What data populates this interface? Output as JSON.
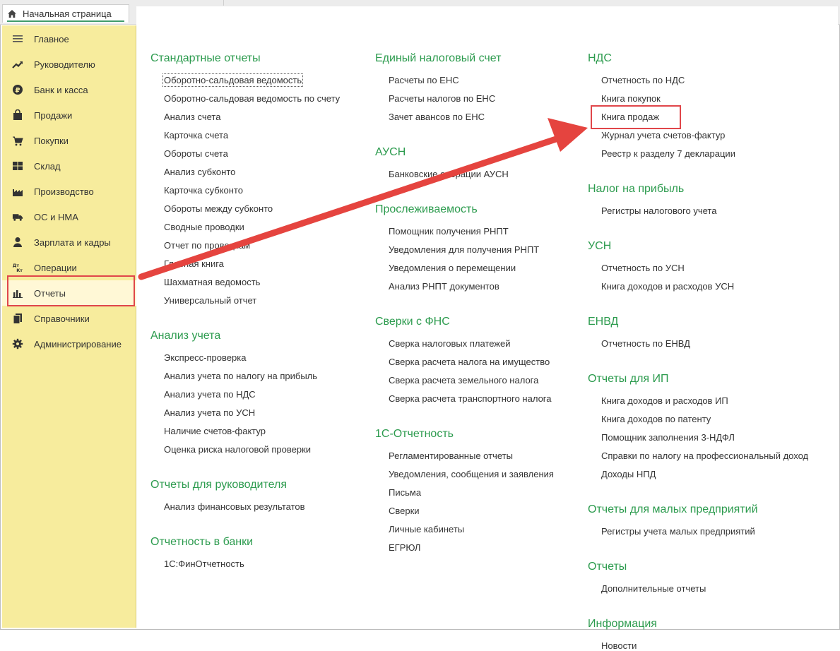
{
  "window": {
    "home_tab": "Начальная страница"
  },
  "sidebar": {
    "items": [
      {
        "label": "Главное",
        "icon": "menu-lines-icon"
      },
      {
        "label": "Руководителю",
        "icon": "trend-up-icon"
      },
      {
        "label": "Банк и касса",
        "icon": "ruble-coin-icon"
      },
      {
        "label": "Продажи",
        "icon": "shopping-bag-icon"
      },
      {
        "label": "Покупки",
        "icon": "cart-icon"
      },
      {
        "label": "Склад",
        "icon": "warehouse-grid-icon"
      },
      {
        "label": "Производство",
        "icon": "factory-icon"
      },
      {
        "label": "ОС и НМА",
        "icon": "truck-icon"
      },
      {
        "label": "Зарплата и кадры",
        "icon": "person-icon"
      },
      {
        "label": "Операции",
        "icon": "debit-credit-icon"
      },
      {
        "label": "Отчеты",
        "icon": "bar-chart-icon",
        "active": true
      },
      {
        "label": "Справочники",
        "icon": "books-icon"
      },
      {
        "label": "Администрирование",
        "icon": "gear-icon"
      }
    ]
  },
  "columns": [
    {
      "sections": [
        {
          "title": "Стандартные отчеты",
          "links": [
            "Оборотно-сальдовая ведомость",
            "Оборотно-сальдовая ведомость по счету",
            "Анализ счета",
            "Карточка счета",
            "Обороты счета",
            "Анализ субконто",
            "Карточка субконто",
            "Обороты между субконто",
            "Сводные проводки",
            "Отчет по проводкам",
            "Главная книга",
            "Шахматная ведомость",
            "Универсальный отчет"
          ]
        },
        {
          "title": "Анализ учета",
          "links": [
            "Экспресс-проверка",
            "Анализ учета по налогу на прибыль",
            "Анализ учета по НДС",
            "Анализ учета по УСН",
            "Наличие счетов-фактур",
            "Оценка риска налоговой проверки"
          ]
        },
        {
          "title": "Отчеты для руководителя",
          "links": [
            "Анализ финансовых результатов"
          ]
        },
        {
          "title": "Отчетность в банки",
          "links": [
            "1С:ФинОтчетность"
          ]
        }
      ]
    },
    {
      "sections": [
        {
          "title": "Единый налоговый счет",
          "links": [
            "Расчеты по ЕНС",
            "Расчеты налогов по ЕНС",
            "Зачет авансов по ЕНС"
          ]
        },
        {
          "title": "АУСН",
          "links": [
            "Банковские операции АУСН"
          ]
        },
        {
          "title": "Прослеживаемость",
          "links": [
            "Помощник получения РНПТ",
            "Уведомления для получения РНПТ",
            "Уведомления о перемещении",
            "Анализ РНПТ документов"
          ]
        },
        {
          "title": "Сверки с ФНС",
          "links": [
            "Сверка налоговых платежей",
            "Сверка расчета налога на имущество",
            "Сверка расчета земельного налога",
            "Сверка расчета транспортного налога"
          ]
        },
        {
          "title": "1С-Отчетность",
          "links": [
            "Регламентированные отчеты",
            "Уведомления, сообщения и заявления",
            "Письма",
            "Сверки",
            "Личные кабинеты",
            "ЕГРЮЛ"
          ]
        }
      ]
    },
    {
      "sections": [
        {
          "title": "НДС",
          "links": [
            "Отчетность по НДС",
            "Книга покупок",
            "Книга продаж",
            "Журнал учета счетов-фактур",
            "Реестр к разделу 7 декларации"
          ]
        },
        {
          "title": "Налог на прибыль",
          "links": [
            "Регистры налогового учета"
          ]
        },
        {
          "title": "УСН",
          "links": [
            "Отчетность по УСН",
            "Книга доходов и расходов УСН"
          ]
        },
        {
          "title": "ЕНВД",
          "links": [
            "Отчетность по ЕНВД"
          ]
        },
        {
          "title": "Отчеты для ИП",
          "links": [
            "Книга доходов и расходов ИП",
            "Книга доходов по патенту",
            "Помощник заполнения 3-НДФЛ",
            "Справки по налогу на профессиональный доход",
            "Доходы НПД"
          ]
        },
        {
          "title": "Отчеты для малых предприятий",
          "links": [
            "Регистры учета малых предприятий"
          ]
        },
        {
          "title": "Отчеты",
          "links": [
            "Дополнительные отчеты"
          ]
        },
        {
          "title": "Информация",
          "links": [
            "Новости"
          ]
        }
      ]
    }
  ],
  "colors": {
    "sidebar_bg": "#f7ec9d",
    "section_title": "#2c9b4e",
    "highlight": "#e0464a"
  }
}
